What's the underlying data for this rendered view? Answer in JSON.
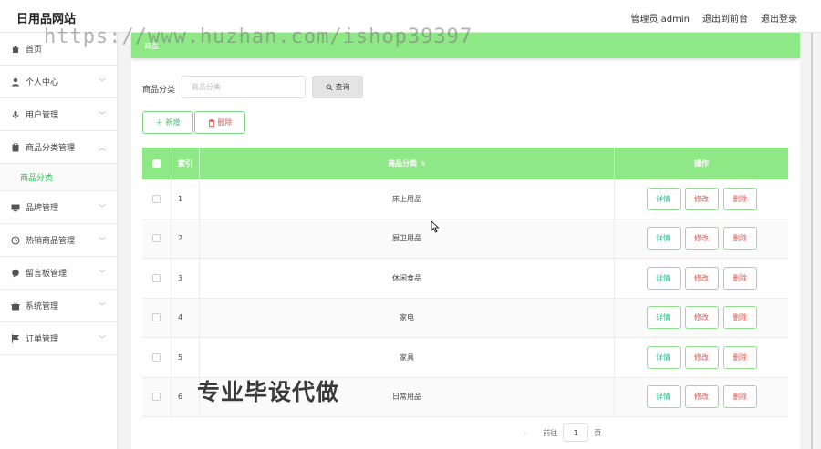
{
  "header": {
    "brand": "日用品网站",
    "user": "管理员 admin",
    "back_to_front": "退出到前台",
    "logout": "退出登录"
  },
  "watermark": "https://www.huzhan.com/ishop39397",
  "sidebar": {
    "items": [
      {
        "label": "首页",
        "icon": "home-icon",
        "chevron": false
      },
      {
        "label": "个人中心",
        "icon": "user-icon",
        "chevron": true
      },
      {
        "label": "用户管理",
        "icon": "microphone-icon",
        "chevron": true
      },
      {
        "label": "商品分类管理",
        "icon": "clipboard-icon",
        "chevron": true,
        "expanded": true
      }
    ],
    "sub_item": "商品分类",
    "items_after": [
      {
        "label": "品牌管理",
        "icon": "monitor-icon"
      },
      {
        "label": "热销商品管理",
        "icon": "clock-icon"
      },
      {
        "label": "留言板管理",
        "icon": "comment-icon"
      },
      {
        "label": "系统管理",
        "icon": "gift-icon"
      },
      {
        "label": "订单管理",
        "icon": "flag-icon"
      }
    ]
  },
  "breadcrumb": "商品",
  "filter": {
    "label": "商品分类",
    "placeholder": "商品分类",
    "query_button": "查询"
  },
  "toolbar": {
    "add_label": "新增",
    "delete_label": "删除"
  },
  "table": {
    "headers": {
      "index": "索引",
      "name": "商品分类",
      "ops": "操作"
    },
    "rows": [
      {
        "index": "1",
        "name": "床上用品"
      },
      {
        "index": "2",
        "name": "厨卫用品"
      },
      {
        "index": "3",
        "name": "休闲食品"
      },
      {
        "index": "4",
        "name": "家电"
      },
      {
        "index": "5",
        "name": "家具"
      },
      {
        "index": "6",
        "name": "日常用品"
      }
    ],
    "ops": {
      "detail": "详情",
      "edit": "修改",
      "remove": "删除"
    }
  },
  "pager": {
    "goto_label": "前往",
    "page_value": "1",
    "page_unit": "页"
  },
  "overlay_text": "专业毕设代做",
  "colors": {
    "accent_green": "#8fe886",
    "sub_active": "#2fbf5a",
    "danger": "#e0574f"
  }
}
